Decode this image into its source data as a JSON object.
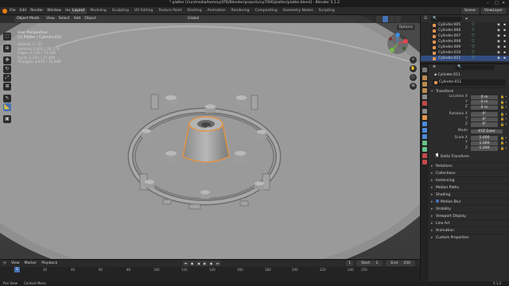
{
  "window": {
    "title": "* platter [/run/media/tommy/4TB/Blender/projects/cp7000/platter/platter.blend] - Blender 5.1.2",
    "controls": [
      "–",
      "□",
      "✕"
    ]
  },
  "menubar": {
    "menus": [
      "File",
      "Edit",
      "Render",
      "Window",
      "Help"
    ],
    "workspaces": [
      "Layout",
      "Modeling",
      "Sculpting",
      "UV Editing",
      "Texture Paint",
      "Shading",
      "Animation",
      "Rendering",
      "Compositing",
      "Geometry Nodes",
      "Scripting"
    ],
    "active_workspace": "Layout",
    "scene_label": "Scene",
    "view_layer_label": "ViewLayer"
  },
  "viewport": {
    "mode": "Object Mode",
    "menus": [
      "View",
      "Select",
      "Add",
      "Object"
    ],
    "orientation": "Global",
    "options": "Options",
    "view_name": "User Perspective",
    "collection_info": "(1) Platter | Cylinder.011",
    "stats": [
      {
        "label": "Objects",
        "value": "1 / 21"
      },
      {
        "label": "Vertices",
        "value": "2,432 / 39,174"
      },
      {
        "label": "Edges",
        "value": "4,736 / 74,500"
      },
      {
        "label": "Faces",
        "value": "2,320 / 37,394"
      },
      {
        "label": "Triangles",
        "value": "4,672 / 74,648"
      }
    ],
    "tools": [
      "cursor-icon",
      "move-icon",
      "rotate-icon",
      "scale-icon",
      "transform-icon",
      "annotate-icon",
      "measure-icon",
      "add-cube-icon"
    ],
    "active_tool": "scale-icon",
    "nav_buttons": [
      "+",
      "✋",
      "🎥",
      "⊞"
    ]
  },
  "outliner": {
    "search_placeholder": "",
    "items": [
      {
        "name": "Cylinder.005",
        "selected": false
      },
      {
        "name": "Cylinder.006",
        "selected": false
      },
      {
        "name": "Cylinder.007",
        "selected": false
      },
      {
        "name": "Cylinder.008",
        "selected": false
      },
      {
        "name": "Cylinder.009",
        "selected": false
      },
      {
        "name": "Cylinder.010",
        "selected": false
      },
      {
        "name": "Cylinder.011",
        "selected": true
      }
    ]
  },
  "properties": {
    "breadcrumb": "Cylinder.011",
    "object_name": "Cylinder.011",
    "transform": {
      "title": "Transform",
      "location": {
        "label": "Location X",
        "x": "0 m",
        "y": "0 m",
        "z": "0 m"
      },
      "rotation": {
        "label": "Rotation X",
        "x": "0°",
        "y": "0°",
        "z": "0°"
      },
      "mode_label": "Mode",
      "mode_value": "XYZ Euler",
      "scale": {
        "label": "Scale X",
        "x": "1.000",
        "y": "1.000",
        "z": "1.000"
      },
      "delta": "Delta Transform"
    },
    "panels": [
      "Relations",
      "Collections",
      "Instancing",
      "Motion Paths",
      "Shading",
      "Motion Blur",
      "Visibility",
      "Viewport Display",
      "Line Art",
      "Animation",
      "Custom Properties"
    ]
  },
  "timeline": {
    "menus": [
      "View",
      "Marker",
      "Playback"
    ],
    "current_frame": "1",
    "start_label": "Start",
    "start": "1",
    "end_label": "End",
    "end": "250",
    "ruler": [
      "1",
      "20",
      "40",
      "60",
      "80",
      "100",
      "120",
      "140",
      "160",
      "180",
      "200",
      "220",
      "240",
      "250"
    ]
  },
  "statusbar": {
    "left": "Pan View",
    "middle": "Context Menu",
    "version": "5.1.2"
  },
  "colors": {
    "accent": "#4772b3",
    "selection_outline": "#e8923a",
    "object_orange": "#e39550",
    "mesh_green": "#67c18b"
  }
}
